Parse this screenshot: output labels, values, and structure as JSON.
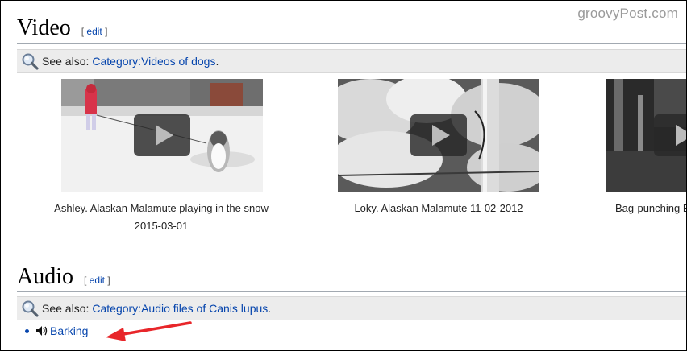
{
  "watermark": "groovyPost.com",
  "video_section": {
    "heading": "Video",
    "edit_label": "edit",
    "see_also_prefix": "See also:",
    "see_also_link": "Category:Videos of dogs",
    "videos": [
      {
        "caption_line1": "Ashley. Alaskan Malamute playing in the snow",
        "caption_line2": "2015-03-01"
      },
      {
        "caption_line1": "Loky. Alaskan Malamute 11-02-2012",
        "caption_line2": ""
      },
      {
        "caption_line1": "Bag-punching B",
        "caption_line2": ""
      }
    ]
  },
  "audio_section": {
    "heading": "Audio",
    "edit_label": "edit",
    "see_also_prefix": "See also:",
    "see_also_link": "Category:Audio files of Canis lupus",
    "items": [
      {
        "label": "Barking"
      }
    ]
  },
  "colors": {
    "link": "#0645ad",
    "annotation_arrow": "#e8262a",
    "see_also_bg": "#ececec"
  },
  "icons": {
    "see_also": "magnifier-icon",
    "audio": "speaker-icon",
    "video": "play-icon"
  }
}
